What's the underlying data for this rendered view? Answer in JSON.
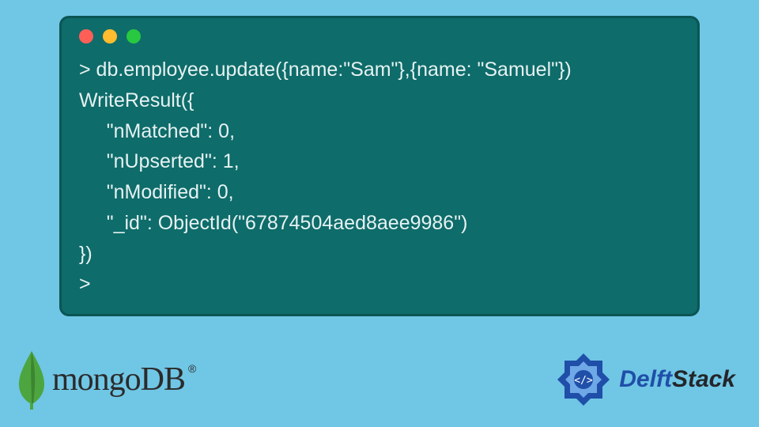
{
  "terminal": {
    "lines": [
      "> db.employee.update({name:\"Sam\"},{name: \"Samuel\"})",
      "WriteResult({",
      "     \"nMatched\": 0,",
      "     \"nUpserted\": 1,",
      "     \"nModified\": 0,",
      "     \"_id\": ObjectId(\"67874504aed8aee9986\")",
      "})",
      ">"
    ]
  },
  "brand": {
    "mongo": "mongoDB",
    "mongo_reg": "®",
    "delft_a": "Delft",
    "delft_b": "Stack"
  },
  "colors": {
    "page_bg": "#70c6e5",
    "terminal_bg": "#0e6c6a",
    "terminal_border": "#0a5554",
    "terminal_text": "#e6f2f2",
    "mongo_leaf": "#4da53f",
    "delft_primary": "#1f4fa8",
    "delft_dark": "#23262a"
  }
}
